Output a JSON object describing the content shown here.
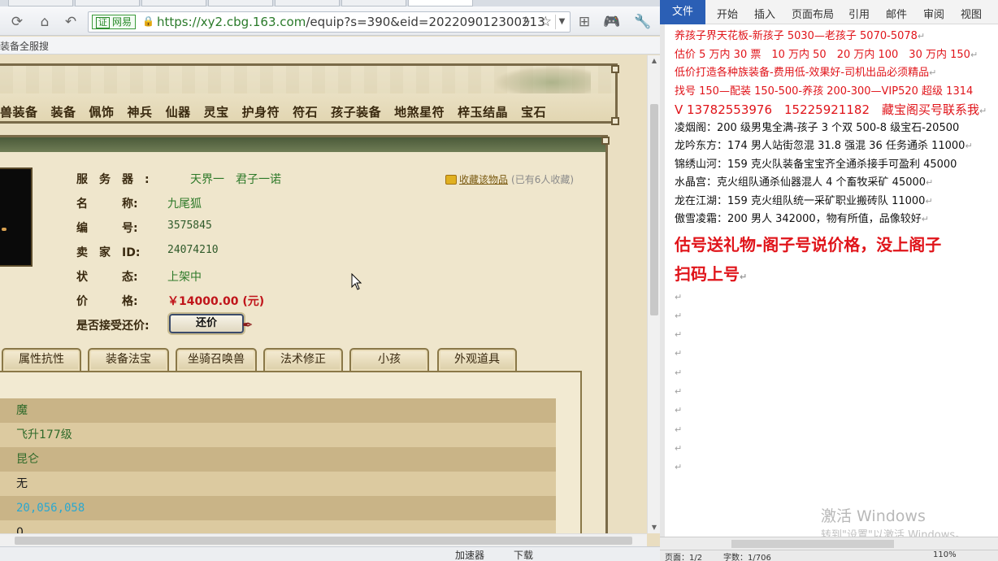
{
  "browser": {
    "nav_icons": [
      "refresh-icon",
      "home-icon",
      "back-icon"
    ],
    "address": {
      "cert_label": "网易",
      "url_main": "https://xy2.cbg.163.com",
      "url_rest": "/equip?s=390&eid=202209012300213"
    },
    "bookmarks_label": "装备全服搜",
    "status_left": "加速器",
    "status_right": "下载"
  },
  "page": {
    "nav_menu": [
      "兽装备",
      "装备",
      "佩饰",
      "神兵",
      "仙器",
      "灵宝",
      "护身符",
      "符石",
      "孩子装备",
      "地煞星符",
      "梓玉结晶",
      "宝石"
    ],
    "info": {
      "server_key": "服　务　器　:",
      "server_val": "天界一　君子一诺",
      "name_key": "名　　　称:",
      "name_val": "九尾狐",
      "id_key": "编　　　号:",
      "id_val": "3575845",
      "seller_key": "卖　家　ID:",
      "seller_val": "24074210",
      "state_key": "状　　　态:",
      "state_val": "上架中",
      "price_key": "价　　　格:",
      "price_val": "￥14000.00 (元)",
      "offer_key": "是否接受还价:",
      "offer_btn": "还价"
    },
    "favorite": {
      "link": "收藏该物品",
      "count": "(已有6人收藏)"
    },
    "tabs": [
      "属性抗性",
      "装备法宝",
      "坐骑召唤兽",
      "法术修正",
      "小孩",
      "外观道具"
    ],
    "detail_rows": [
      "魔",
      "飞升177级",
      "昆仑",
      "无",
      "20,056,058",
      "0"
    ]
  },
  "word": {
    "ribbon": {
      "file": "文件",
      "tabs": [
        "开始",
        "插入",
        "页面布局",
        "引用",
        "邮件",
        "审阅",
        "视图"
      ]
    },
    "lines_red": [
      "养孩子界天花板-新孩子 5030—老孩子 5070-5078",
      "估价 5 万内 30 票　10 万内 50　20 万内 100　30 万内 150",
      "低价打造各种族装备-费用低-效果好-司机出品必须精品",
      "找号 150—配装 150-500-养孩 200-300—VIP520 超级 1314",
      "V 13782553976　15225921182　藏宝阁买号联系我"
    ],
    "lines_black": [
      "凌烟阁：200 级男鬼全满-孩子 3 个双 500-8 级宝石-20500",
      "龙吟东方：174 男人站街忽混 31.8 强混 36 任务通杀 11000",
      "锦绣山河：159 克火队装备宝宝齐全通杀接手可盈利 45000",
      "水晶宫：克火组队通杀仙器混人 4 个畜牧采矿 45000",
      "龙在江湖：159 克火组队统一采矿职业搬砖队 11000",
      "傲雪凌霜：200 男人 342000，物有所值，品像较好"
    ],
    "headline1": "估号送礼物-阁子号说价格，没上阁子",
    "headline2": "扫码上号",
    "watermark1": "激活 Windows",
    "watermark2": "转到\"设置\"以激活 Windows。",
    "status_left": "页面：1/2",
    "status_mid": "字数：1/706",
    "status_zoom": "110%"
  }
}
